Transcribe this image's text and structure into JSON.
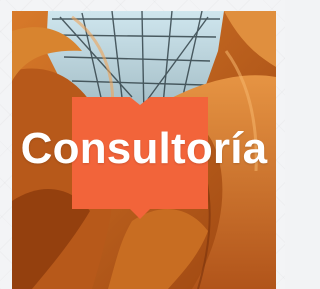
{
  "card": {
    "title": "Consultoría"
  },
  "colors": {
    "accent": "#f2643a",
    "wood": "#c4661b",
    "text": "#ffffff"
  },
  "icons": {
    "brand_mark": "book-shape-icon"
  }
}
